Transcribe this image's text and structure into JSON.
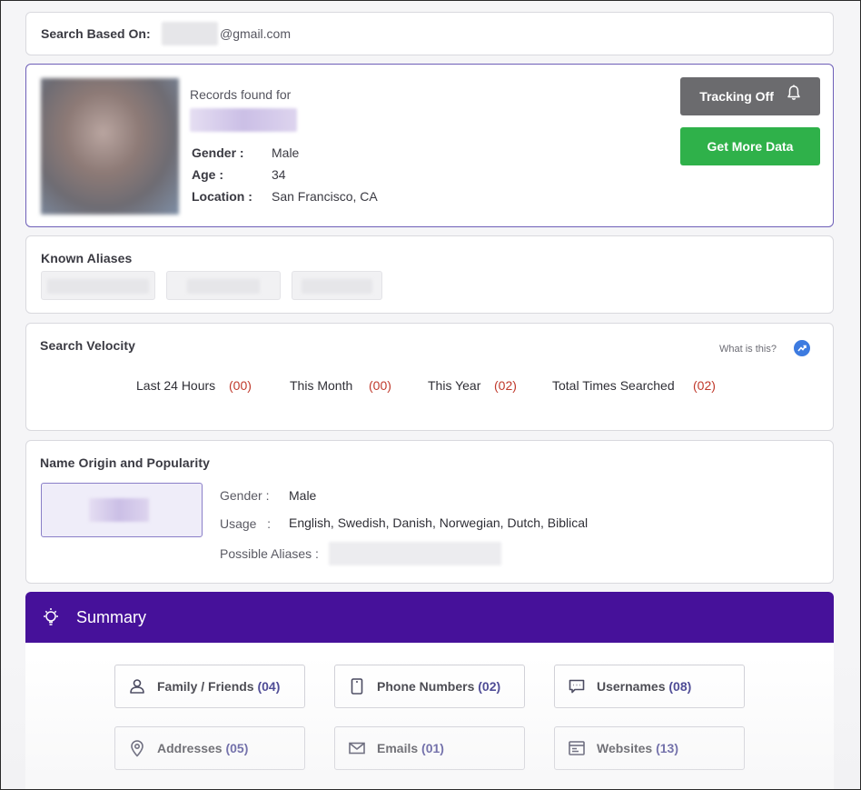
{
  "search": {
    "label": "Search Based On:",
    "email_suffix": "@gmail.com"
  },
  "profile": {
    "records_found_label": "Records found for",
    "gender_label": "Gender :",
    "gender_value": "Male",
    "age_label": "Age :",
    "age_value": "34",
    "location_label": "Location :",
    "location_value": "San Francisco, CA",
    "tracking_button": "Tracking Off",
    "more_button": "Get More Data"
  },
  "aliases": {
    "title": "Known Aliases"
  },
  "velocity": {
    "title": "Search Velocity",
    "help_text": "What is this?",
    "stats": [
      {
        "label": "Last 24 Hours",
        "count": "(00)"
      },
      {
        "label": "This Month",
        "count": "(00)"
      },
      {
        "label": "This Year",
        "count": "(02)"
      },
      {
        "label": "Total Times Searched",
        "count": "(02)"
      }
    ]
  },
  "origin": {
    "title": "Name Origin and Popularity",
    "gender_label": "Gender :",
    "gender_value": "Male",
    "usage_label": "Usage   :",
    "usage_value": "English, Swedish, Danish, Norwegian, Dutch, Biblical",
    "aliases_label": "Possible Aliases :"
  },
  "summary": {
    "title": "Summary",
    "items": [
      {
        "label": "Family / Friends",
        "count": "(04)",
        "icon": "person-icon"
      },
      {
        "label": "Phone Numbers",
        "count": "(02)",
        "icon": "phone-icon"
      },
      {
        "label": "Usernames",
        "count": "(08)",
        "icon": "chat-icon"
      },
      {
        "label": "Addresses",
        "count": "(05)",
        "icon": "location-pin-icon"
      },
      {
        "label": "Emails",
        "count": "(01)",
        "icon": "envelope-icon"
      },
      {
        "label": "Websites",
        "count": "(13)",
        "icon": "browser-window-icon"
      }
    ]
  },
  "colors": {
    "summary_header": "#46119a",
    "get_more_data": "#2fb14a",
    "tracking_off": "#6b6b6e",
    "count_red": "#c0392b",
    "help_blue": "#3d7be0"
  }
}
